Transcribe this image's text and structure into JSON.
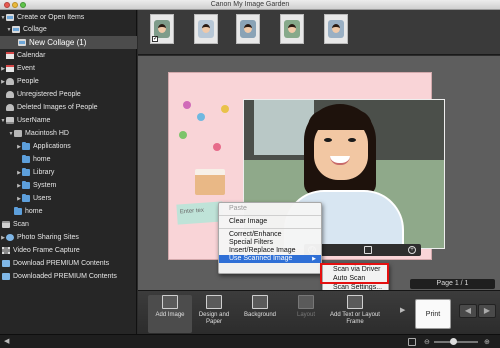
{
  "window": {
    "title": "Canon My Image Garden"
  },
  "sidebar": {
    "items": [
      {
        "label": "Create or Open Items",
        "expanded": true,
        "icon": "folder-doc-icon"
      },
      {
        "label": "Collage",
        "expanded": true,
        "icon": "collage-icon"
      },
      {
        "label": "New Collage (1)",
        "selected": true,
        "icon": "doc-icon"
      },
      {
        "label": "Calendar",
        "icon": "calendar-icon"
      },
      {
        "label": "Event",
        "icon": "event-icon"
      },
      {
        "label": "People",
        "icon": "people-icon"
      },
      {
        "label": "Unregistered People",
        "icon": "people-icon"
      },
      {
        "label": "Deleted Images of People",
        "icon": "trash-icon"
      },
      {
        "label": "UserName",
        "icon": "computer-icon"
      },
      {
        "label": "Macintosh HD",
        "icon": "disk-icon"
      },
      {
        "label": "Applications",
        "icon": "folder-icon"
      },
      {
        "label": "home",
        "icon": "folder-icon"
      },
      {
        "label": "Library",
        "icon": "folder-icon"
      },
      {
        "label": "System",
        "icon": "folder-icon"
      },
      {
        "label": "Users",
        "icon": "folder-icon"
      },
      {
        "label": "home",
        "icon": "folder-icon"
      },
      {
        "label": "Scan",
        "icon": "scanner-icon"
      },
      {
        "label": "Photo Sharing Sites",
        "icon": "globe-icon"
      },
      {
        "label": "Video Frame Capture",
        "icon": "film-icon"
      },
      {
        "label": "Download PREMIUM Contents",
        "icon": "download-icon"
      },
      {
        "label": "Downloaded PREMIUM Contents",
        "icon": "download-icon"
      }
    ]
  },
  "canvas": {
    "textbox_placeholder": "Enter tex",
    "page_indicator": "Page 1 / 1"
  },
  "context_menu": {
    "items": [
      {
        "label": "Paste",
        "disabled": true
      },
      {
        "label": "Clear Image"
      },
      {
        "label": "Correct/Enhance"
      },
      {
        "label": "Special Filters"
      },
      {
        "label": "Insert/Replace Image"
      },
      {
        "label": "Use Scanned Image",
        "highlighted": true,
        "has_submenu": true
      }
    ],
    "submenu": [
      {
        "label": "Scan via Driver"
      },
      {
        "label": "Auto Scan"
      },
      {
        "label": "Scan Settings..."
      }
    ]
  },
  "toolbar": {
    "add_image": "Add Image",
    "design_and_paper": "Design and Paper",
    "background": "Background",
    "layout": "Layout",
    "add_text_or_layout_frame": "Add Text or Layout Frame",
    "print": "Print"
  },
  "colors": {
    "menu_highlight": "#2f6fd6",
    "callout_red": "#e41010",
    "page_pink": "#f9d4d7"
  }
}
